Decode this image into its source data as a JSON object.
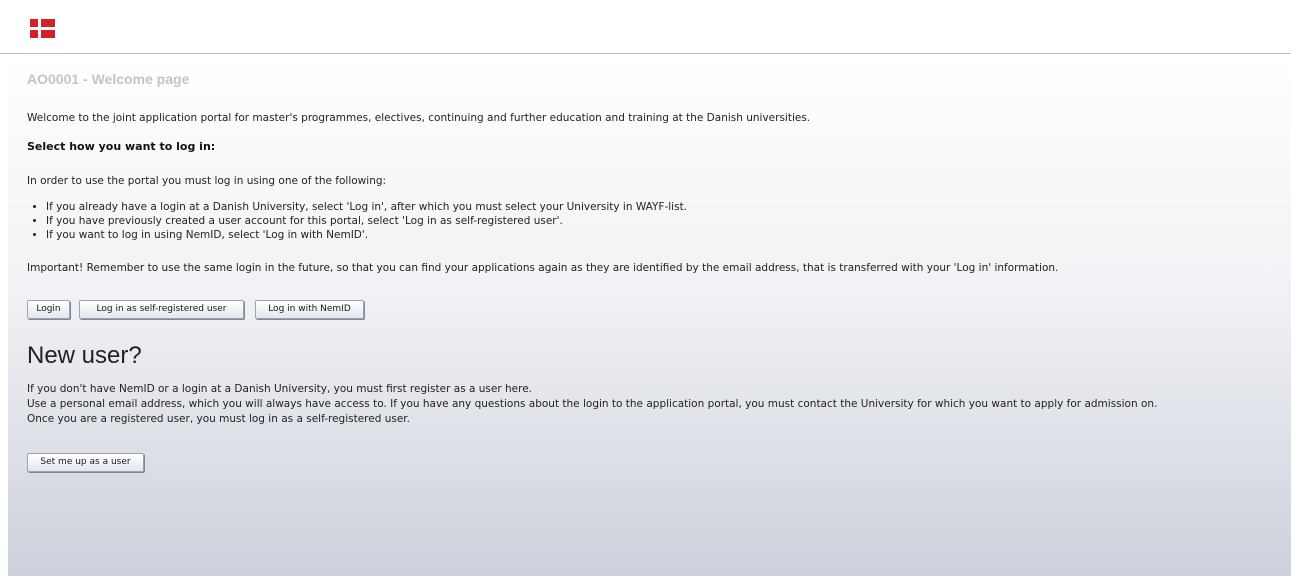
{
  "header": {
    "flag_icon": "danish-flag-icon",
    "flag_colors": {
      "red": "#d41f2c",
      "white": "#ffffff"
    }
  },
  "page": {
    "title": "AO0001 - Welcome page",
    "welcome": "Welcome to the joint application portal for master's programmes, electives, continuing and further education and training at the Danish universities.",
    "select_heading": "Select how you want to log in:",
    "intro": "In order to use the portal you must log in using one of the following:",
    "bullets": [
      "If you already have a login at a Danish University, select 'Log in', after which you must select your University in WAYF-list.",
      "If you have previously created a user account for this portal, select 'Log in as self-registered user'.",
      "If you want to log in using NemID, select 'Log in with NemID'."
    ],
    "important": "Important! Remember to use the same login in the future, so that you can find your applications again as they are identified by the email address, that is transferred with your 'Log in' information."
  },
  "buttons": {
    "login": "Login",
    "self_registered": "Log in as self-registered user",
    "nemid": "Log in with NemID",
    "setup_user": "Set me up as a user"
  },
  "new_user": {
    "heading": "New user?",
    "lines": [
      "If you don't have NemID or a login at a Danish University, you must first register as a user here.",
      "Use a personal email address, which you will always have access to. If you have any questions about the login to the application portal, you must contact the University for which you want to apply for admission on.",
      "Once you are a registered user, you must log in as a self-registered user."
    ]
  }
}
